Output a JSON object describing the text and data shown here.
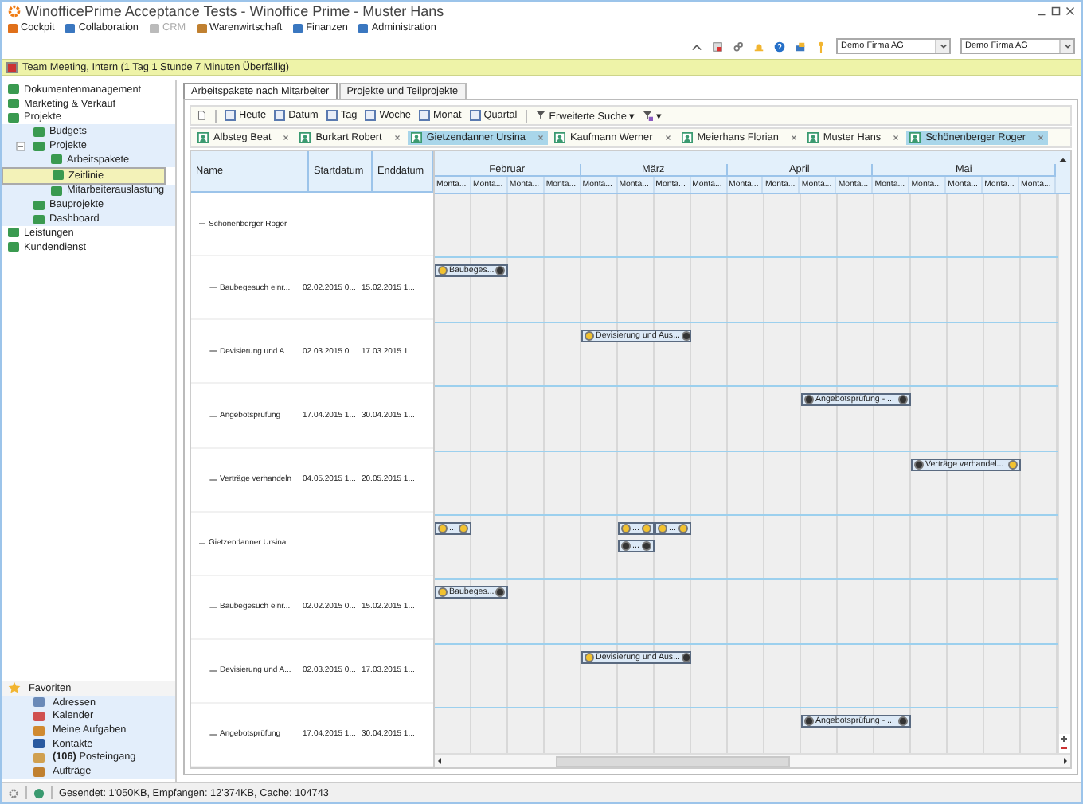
{
  "window": {
    "title": "WinofficePrime Acceptance Tests - Winoffice Prime - Muster Hans"
  },
  "menu": [
    {
      "label": "Cockpit",
      "disabled": false
    },
    {
      "label": "Collaboration",
      "disabled": false
    },
    {
      "label": "CRM",
      "disabled": true
    },
    {
      "label": "Warenwirtschaft",
      "disabled": false
    },
    {
      "label": "Finanzen",
      "disabled": false
    },
    {
      "label": "Administration",
      "disabled": false
    }
  ],
  "company_selects": [
    "Demo Firma AG",
    "Demo Firma AG"
  ],
  "reminder": "Team Meeting, Intern (1 Tag 1 Stunde 7 Minuten Überfällig)",
  "sidebar": {
    "items": [
      {
        "label": "Dokumentenmanagement",
        "selected": false
      },
      {
        "label": "Marketing & Verkauf",
        "selected": false
      },
      {
        "label": "Projekte",
        "selected": false,
        "expanded": true,
        "children": [
          {
            "label": "Budgets",
            "selected": false
          },
          {
            "label": "Projekte",
            "selected": false,
            "expanded": true,
            "children": [
              {
                "label": "Arbeitspakete",
                "selected": false
              },
              {
                "label": "Zeitlinie",
                "selected": true
              },
              {
                "label": "Mitarbeiterauslastung",
                "selected": false
              }
            ]
          },
          {
            "label": "Bauprojekte",
            "selected": false
          },
          {
            "label": "Dashboard",
            "selected": false
          }
        ]
      },
      {
        "label": "Leistungen",
        "selected": false
      },
      {
        "label": "Kundendienst",
        "selected": false
      }
    ],
    "favorites_title": "Favoriten",
    "favorites": [
      "Adressen",
      "Kalender",
      "Meine Aufgaben",
      "Kontakte",
      "**(106)** Posteingang",
      "Aufträge"
    ]
  },
  "tabs": [
    {
      "label": "Arbeitspakete nach Mitarbeiter",
      "selected": true
    },
    {
      "label": "Projekte und Teilprojekte",
      "selected": false
    }
  ],
  "toolbar": [
    "Heute",
    "Datum",
    "Tag",
    "Woche",
    "Monat",
    "Quartal"
  ],
  "search_button": {
    "label": "Erweiterte Suche",
    "caret": "▾"
  },
  "filter_button": {
    "caret": "▾"
  },
  "people": [
    {
      "label": "Albsteg Beat",
      "selected": false
    },
    {
      "label": "Burkart Robert",
      "selected": false
    },
    {
      "label": "Gietzendanner Ursina",
      "selected": true
    },
    {
      "label": "Kaufmann Werner",
      "selected": false
    },
    {
      "label": "Meierhans Florian",
      "selected": false
    },
    {
      "label": "Muster Hans",
      "selected": false
    },
    {
      "label": "Schönenberger Roger",
      "selected": true
    }
  ],
  "table": {
    "columns": [
      "Name",
      "Startdatum",
      "Enddatum"
    ],
    "rows": [
      {
        "kind": "group",
        "name": "Schönenberger Roger",
        "lanes": []
      },
      {
        "kind": "task",
        "name": "Baubegesuch einr...",
        "start": "02.02.2015 0...",
        "end": "15.02.2015 1...",
        "lanes": [
          [
            {
              "kind": "bar",
              "label": "Baubeges...",
              "icons": [
                {
                  "kind": "clock"
                },
                {
                  "kind": "info"
                }
              ]
            },
            {
              "kind": "continued"
            }
          ]
        ]
      },
      {
        "kind": "task",
        "name": "Devisierung und A...",
        "start": "02.03.2015 0...",
        "end": "17.03.2015 1...",
        "lanes": [
          [
            {
              "kind": "empty"
            },
            {
              "kind": "empty"
            },
            {
              "kind": "empty"
            },
            {
              "kind": "empty"
            },
            {
              "kind": "bar",
              "label": "Devisierung und Aus...",
              "icons": [
                {
                  "kind": "clock"
                },
                {
                  "kind": "info"
                }
              ]
            },
            {
              "kind": "continued"
            },
            {
              "kind": "continued"
            }
          ]
        ]
      },
      {
        "kind": "task",
        "name": "Angebotsprüfung",
        "start": "17.04.2015 1...",
        "end": "30.04.2015 1...",
        "lanes": [
          [
            {
              "kind": "empty"
            },
            {
              "kind": "empty"
            },
            {
              "kind": "empty"
            },
            {
              "kind": "empty"
            },
            {
              "kind": "empty"
            },
            {
              "kind": "empty"
            },
            {
              "kind": "empty"
            },
            {
              "kind": "empty"
            },
            {
              "kind": "empty"
            },
            {
              "kind": "empty"
            },
            {
              "kind": "bar",
              "label": "Angebotsprüfung - ...",
              "icons": [
                {
                  "kind": "info"
                },
                {
                  "kind": "info"
                }
              ]
            },
            {
              "kind": "continued"
            },
            {
              "kind": "continued"
            }
          ]
        ]
      },
      {
        "kind": "task",
        "name": "Verträge verhandeln",
        "start": "04.05.2015 1...",
        "end": "20.05.2015 1...",
        "lanes": [
          [
            {
              "kind": "empty"
            },
            {
              "kind": "empty"
            },
            {
              "kind": "empty"
            },
            {
              "kind": "empty"
            },
            {
              "kind": "empty"
            },
            {
              "kind": "empty"
            },
            {
              "kind": "empty"
            },
            {
              "kind": "empty"
            },
            {
              "kind": "empty"
            },
            {
              "kind": "empty"
            },
            {
              "kind": "empty"
            },
            {
              "kind": "empty"
            },
            {
              "kind": "empty"
            },
            {
              "kind": "bar",
              "label": "Verträge verhandel...",
              "icons": [
                {
                  "kind": "info"
                },
                {
                  "kind": "clock"
                }
              ]
            },
            {
              "kind": "continued"
            },
            {
              "kind": "continued"
            }
          ]
        ]
      },
      {
        "kind": "group",
        "name": "Gietzendanner Ursina",
        "lanes": [
          [
            {
              "kind": "bar",
              "label": "...",
              "icons": [
                {
                  "kind": "clock"
                },
                {
                  "kind": "clock"
                }
              ]
            },
            {
              "kind": "empty"
            },
            {
              "kind": "empty"
            },
            {
              "kind": "empty"
            },
            {
              "kind": "empty"
            },
            {
              "kind": "bar",
              "label": "...",
              "icons": [
                {
                  "kind": "clock"
                },
                {
                  "kind": "clock"
                }
              ]
            },
            {
              "kind": "bar",
              "label": "...",
              "icons": [
                {
                  "kind": "clock"
                },
                {
                  "kind": "clock"
                }
              ]
            }
          ],
          [
            {
              "kind": "empty"
            },
            {
              "kind": "empty"
            },
            {
              "kind": "empty"
            },
            {
              "kind": "empty"
            },
            {
              "kind": "empty"
            },
            {
              "kind": "bar",
              "label": "...",
              "icons": [
                {
                  "kind": "info"
                },
                {
                  "kind": "info"
                }
              ]
            }
          ]
        ]
      },
      {
        "kind": "task",
        "name": "Baubegesuch einr...",
        "start": "02.02.2015 0...",
        "end": "15.02.2015 1...",
        "lanes": [
          [
            {
              "kind": "bar",
              "label": "Baubeges...",
              "icons": [
                {
                  "kind": "clock"
                },
                {
                  "kind": "info"
                }
              ]
            },
            {
              "kind": "continued"
            }
          ]
        ]
      },
      {
        "kind": "task",
        "name": "Devisierung und A...",
        "start": "02.03.2015 0...",
        "end": "17.03.2015 1...",
        "lanes": [
          [
            {
              "kind": "empty"
            },
            {
              "kind": "empty"
            },
            {
              "kind": "empty"
            },
            {
              "kind": "empty"
            },
            {
              "kind": "bar",
              "label": "Devisierung und Aus...",
              "icons": [
                {
                  "kind": "clock"
                },
                {
                  "kind": "info"
                }
              ]
            },
            {
              "kind": "continued"
            },
            {
              "kind": "continued"
            }
          ]
        ]
      },
      {
        "kind": "task",
        "name": "Angebotsprüfung",
        "start": "17.04.2015 1...",
        "end": "30.04.2015 1...",
        "lanes": [
          [
            {
              "kind": "empty"
            },
            {
              "kind": "empty"
            },
            {
              "kind": "empty"
            },
            {
              "kind": "empty"
            },
            {
              "kind": "empty"
            },
            {
              "kind": "empty"
            },
            {
              "kind": "empty"
            },
            {
              "kind": "empty"
            },
            {
              "kind": "empty"
            },
            {
              "kind": "empty"
            },
            {
              "kind": "bar",
              "label": "Angebotsprüfung - ...",
              "icons": [
                {
                  "kind": "info"
                },
                {
                  "kind": "info"
                }
              ]
            },
            {
              "kind": "continued"
            },
            {
              "kind": "continued"
            }
          ]
        ]
      }
    ]
  },
  "months": [
    {
      "label": "Februar",
      "weeks": [
        "Monta...",
        "Monta...",
        "Monta...",
        "Monta..."
      ]
    },
    {
      "label": "März",
      "weeks": [
        "Monta...",
        "Monta...",
        "Monta...",
        "Monta..."
      ]
    },
    {
      "label": "April",
      "weeks": [
        "Monta...",
        "Monta...",
        "Monta...",
        "Monta..."
      ]
    },
    {
      "label": "Mai",
      "weeks": [
        "Monta...",
        "Monta...",
        "Monta...",
        "Monta...",
        "Monta..."
      ]
    }
  ],
  "status_bar": "Gesendet: 1'050KB, Empfangen: 12'374KB, Cache: 104743"
}
